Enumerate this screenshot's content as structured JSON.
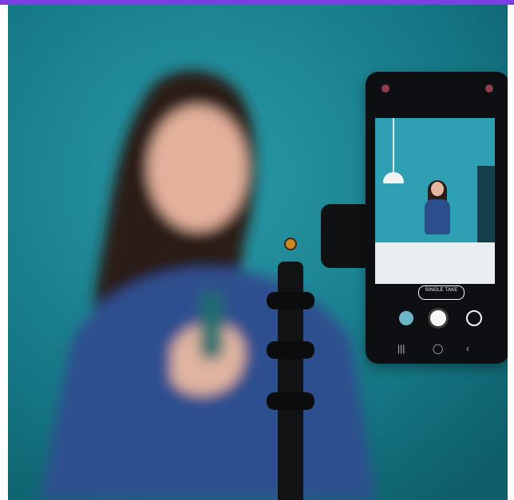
{
  "colors": {
    "page": "#ffffff",
    "accent": "#7b3fe4",
    "background": "#1b7f8c",
    "phone": "#0d0f12"
  },
  "ui": {
    "mode_label": "SINGLE TAKE",
    "nav_back": "|||",
    "nav_home": "◯",
    "nav_recent": "‹"
  }
}
